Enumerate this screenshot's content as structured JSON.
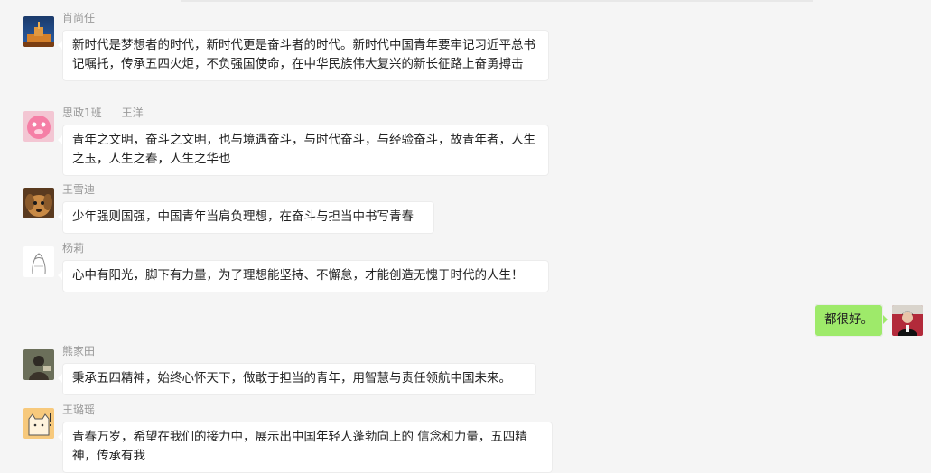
{
  "messages": [
    {
      "sender": "肖尚任",
      "text": "新时代是梦想者的时代，新时代更是奋斗者的时代。新时代中国青年要牢记习近平总书记嘱托，传承五四火炬，不负强国使命，在中华民族伟大复兴的新长征路上奋勇搏击"
    },
    {
      "sender": "思政1班",
      "sender_extra": "王洋",
      "text": "青年之文明，奋斗之文明，也与境遇奋斗，与时代奋斗，与经验奋斗，故青年者，人生之玉，人生之春，人生之华也"
    },
    {
      "sender": "王雪迪",
      "text": "少年强则国强，中国青年当肩负理想，在奋斗与担当中书写青春"
    },
    {
      "sender": "杨莉",
      "text": "心中有阳光，脚下有力量，为了理想能坚持、不懈怠，才能创造无愧于时代的人生！"
    },
    {
      "sender": "",
      "text": "都很好。",
      "mine": true
    },
    {
      "sender": "熊家田",
      "text": "秉承五四精神，始终心怀天下，做敢于担当的青年，用智慧与责任领航中国未来。"
    },
    {
      "sender": "王璐瑶",
      "text": "青春万岁，希望在我们的接力中，展示出中国年轻人蓬勃向上的 信念和力量，五四精神，传承有我"
    }
  ],
  "colors": {
    "background": "#f5f5f5",
    "bubble_incoming": "#ffffff",
    "bubble_outgoing": "#9eea6a",
    "name_text": "#999999"
  },
  "icons": {
    "avatar_1": "city-night-avatar",
    "avatar_2": "pink-cartoon-avatar",
    "avatar_3": "dog-avatar",
    "avatar_4": "line-sketch-avatar",
    "avatar_5": "self-portrait-avatar",
    "avatar_6": "person-dark-avatar",
    "avatar_7": "cat-cartoon-avatar"
  }
}
